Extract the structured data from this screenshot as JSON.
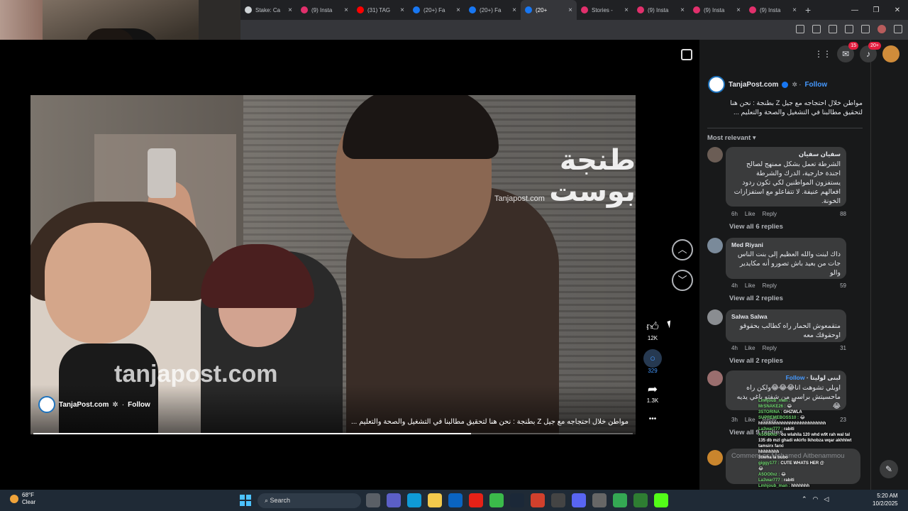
{
  "browser": {
    "tabs": [
      {
        "label": "Stake: Ca",
        "color": "#cdd2d6",
        "active": false
      },
      {
        "label": "(9) Insta",
        "color": "#e1306c",
        "active": false
      },
      {
        "label": "(31) TAG",
        "color": "#ff0000",
        "active": false
      },
      {
        "label": "(20+) Fa",
        "color": "#1877f2",
        "active": false
      },
      {
        "label": "(20+) Fa",
        "color": "#1877f2",
        "active": false
      },
      {
        "label": "(20+",
        "color": "#1877f2",
        "active": true
      },
      {
        "label": "Stories -",
        "color": "#e1306c",
        "active": false
      },
      {
        "label": "(9) Insta",
        "color": "#e1306c",
        "active": false
      },
      {
        "label": "(9) Insta",
        "color": "#e1306c",
        "active": false
      },
      {
        "label": "(9) Insta",
        "color": "#e1306c",
        "active": false
      }
    ],
    "new_tab": "+",
    "window_controls": [
      "—",
      "❐",
      "✕"
    ]
  },
  "video": {
    "watermark_arabic": "طنجة بوست",
    "watermark_small": "Tanjapost.com",
    "watermark_large": "tanjapost.com",
    "page_name": "TanjaPost.com",
    "follow": "Follow",
    "caption": "مواطن خلال احتجاجه مع جيل Z بطنجة : نحن هنا لتحقيق مطالبنا في التشغيل والصحة والتعليم ...",
    "progress": 0.73
  },
  "actions": {
    "like_count": "12K",
    "comment_count": "329",
    "share_count": "1.3K",
    "more": "•••"
  },
  "header_icons": {
    "messenger_badge": "15",
    "notifications_badge": "20+"
  },
  "post": {
    "page_name": "TanjaPost.com",
    "follow": "Follow",
    "text": "مواطن خلال احتجاجه مع جيل Z بطنجة : نحن هنا لتحقيق مطالبنا في التشغيل والصحة والتعليم ...",
    "sort_label": "Most relevant"
  },
  "comments": [
    {
      "name": "سفيان سفيان",
      "text": "الشرطة تعمل بشكل ممنهج لصالح اجندة خارجية، الدرك والشرطة يستفزون المواطنين لكي تكون ردود افعالهم عنيفة. لا تتفاعلو مع استفزازات الخونة.",
      "time": "6h",
      "like": "Like",
      "reply": "Reply",
      "reactions": "88",
      "replies": "View all 6 replies"
    },
    {
      "name": "Med Riyani",
      "text": "داك لبنت والله العظيم إلى بنت الناس جات من بعيد باش تصورو أنه مكايدير والو",
      "time": "4h",
      "like": "Like",
      "reply": "Reply",
      "reactions": "59",
      "replies": "View all 2 replies"
    },
    {
      "name": "Salwa Salwa",
      "text": "متقمعوش الحمار راه كطالب بحقوقو اوحقوقك معه",
      "time": "4h",
      "like": "Like",
      "reply": "Reply",
      "reactions": "31",
      "replies": "View all 2 replies"
    },
    {
      "name": "لبنى لوليتا",
      "follow": "Follow",
      "text": "اويلي تشوهت انا😂😂😂ولكن راه ماحسيتش براسي من شفتو باغي يديه 😂",
      "time": "3h",
      "like": "Like",
      "reply": "Reply",
      "reactions": "23",
      "replies": "View all 9 replies"
    }
  ],
  "write_comment": {
    "placeholder": "Comment as Mohamed Aitbenammou"
  },
  "stream_chat": [
    {
      "user": "Lmhjoub_man :",
      "msg": "😂"
    },
    {
      "user": "MrSNAKE26 :",
      "msg": "😂"
    },
    {
      "user": "3STORINA :",
      "msg": "GHZWLA"
    },
    {
      "user": "SUPREMEBOSS10 :",
      "msg": "😂"
    },
    {
      "user": "",
      "msg": "hhhhhhhhhhhhhhhhhhhhhhhhhh"
    },
    {
      "user": "La3war777 :",
      "msg": "rabiti"
    },
    {
      "user": "A5OO0xz :",
      "msg": "ou wlahila 120 whd w9t rah wal tal 135 db mzl ghadi wkirfo lkhobza wqar akhhlwt tamsirx farxi"
    },
    {
      "user": "",
      "msg": "hhhhhhhh"
    },
    {
      "user": "",
      "msg": "3tiwha la bubo"
    },
    {
      "user": "giggy177 :",
      "msg": "CUTE WHATS HER @"
    },
    {
      "user": "",
      "msg": "😂"
    },
    {
      "user": "A5OO0xz :",
      "msg": "😂"
    },
    {
      "user": "La3war777 :",
      "msg": "rabiti"
    },
    {
      "user": "Lmhjoub_man :",
      "msg": "hhhhhhh"
    }
  ],
  "taskbar": {
    "temperature": "68°F",
    "condition": "Clear",
    "search_label": "Search",
    "time": "5:20 AM",
    "date": "10/2/2025"
  }
}
